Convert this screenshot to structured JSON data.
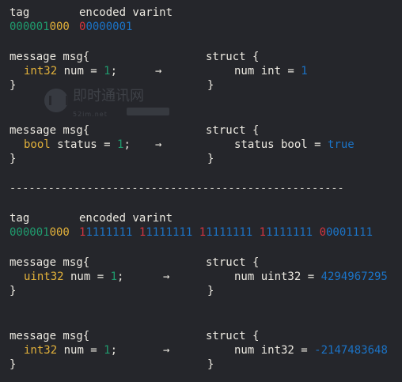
{
  "section1": {
    "tag_label": "tag",
    "varint_label": "encoded varint",
    "tag_bits_a": "000001",
    "tag_bits_b": "000",
    "varint_bits_msb": "0",
    "varint_bits_rest": "0000001"
  },
  "block1": {
    "msg_line": "message msg{",
    "field_type": "int32",
    "field_mid": " num = ",
    "field_value": "1",
    "field_end": ";",
    "close": "}",
    "arrow": "→",
    "struct_line": "struct {",
    "struct_field": "num int = ",
    "struct_value": "1",
    "struct_close": "}"
  },
  "block2": {
    "msg_line": "message msg{",
    "field_type": "bool",
    "field_mid": " status = ",
    "field_value": "1",
    "field_end": ";",
    "close": "}",
    "arrow": "→",
    "struct_line": "struct {",
    "struct_field": "status bool = ",
    "struct_value": "true",
    "struct_close": "}"
  },
  "divider": "----------------------------------------------------",
  "section2": {
    "tag_label": "tag",
    "varint_label": "encoded varint",
    "tag_bits_a": "000001",
    "tag_bits_b": "000",
    "groups": [
      {
        "msb": "1",
        "rest": "1111111"
      },
      {
        "msb": "1",
        "rest": "1111111"
      },
      {
        "msb": "1",
        "rest": "1111111"
      },
      {
        "msb": "1",
        "rest": "1111111"
      },
      {
        "msb": "0",
        "rest": "0001111"
      }
    ]
  },
  "block3": {
    "msg_line": "message msg{",
    "field_type": "uint32",
    "field_mid": " num = ",
    "field_value": "1",
    "field_end": ";",
    "close": "}",
    "arrow": "→",
    "struct_line": "struct {",
    "struct_field": "num uint32 = ",
    "struct_value": "4294967295",
    "struct_close": "}"
  },
  "block4": {
    "msg_line": "message msg{",
    "field_type": "int32",
    "field_mid": " num = ",
    "field_value": "1",
    "field_end": ";",
    "close": "}",
    "arrow": "→",
    "struct_line": "struct {",
    "struct_field": "num int32 = ",
    "struct_value": "-2147483648",
    "struct_close": "}"
  },
  "watermark": {
    "title": "即时通讯网",
    "subtitle": "52im.net"
  },
  "colors": {
    "background": "#25262b",
    "tag_green": "#1f9b6e",
    "tag_yellow": "#e2b13a",
    "varint_blue": "#1b73c6",
    "msb_red": "#d2343f"
  }
}
